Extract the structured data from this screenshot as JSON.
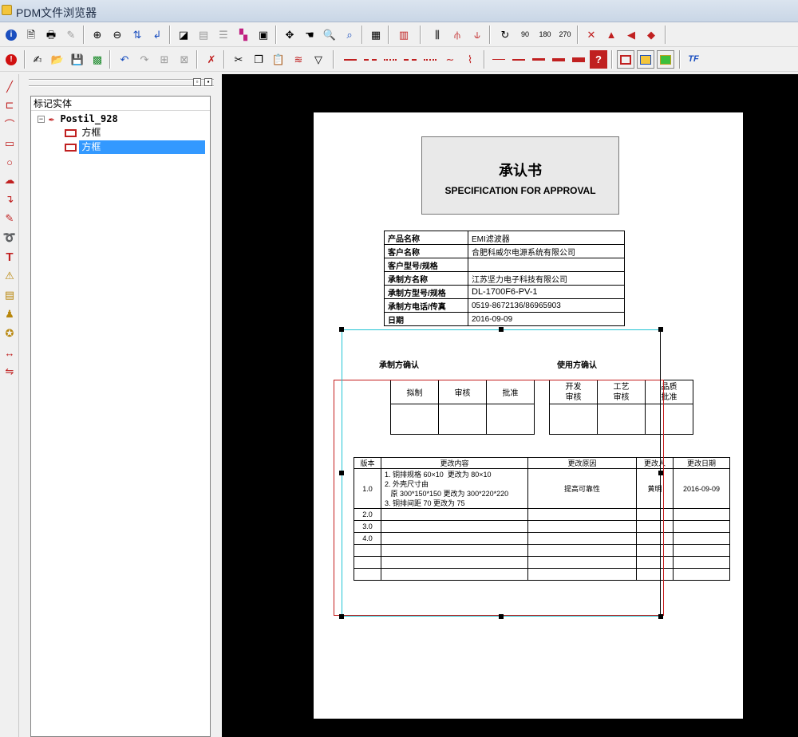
{
  "window": {
    "title": "PDM文件浏览器"
  },
  "toolbar1": {
    "buttons": [
      "info",
      "print-preview",
      "print",
      "pen",
      "zoom-in",
      "zoom-out",
      "fit",
      "pan-left",
      "fill",
      "gray",
      "layers",
      "layers-color",
      "frame",
      "arrow-up",
      "hand",
      "zoom-window",
      "zoom-extents",
      "properties",
      "ruler",
      "flip-h",
      "flip-v",
      "mirror",
      "rotate-0",
      "rotate-90",
      "rotate-180",
      "rotate-270",
      "delete-x",
      "warning",
      "flag-left",
      "flag-right"
    ],
    "rotate_labels": [
      "90",
      "180",
      "270"
    ]
  },
  "toolbar2": {
    "buttons": [
      "info",
      "edit",
      "open",
      "save",
      "save-green",
      "undo",
      "redo",
      "select-all",
      "deselect",
      "eraser",
      "cut",
      "copy",
      "paste",
      "stack",
      "triangle"
    ],
    "line_styles": [
      "solid",
      "dash",
      "dot",
      "dash-dot",
      "dash-dot-dot",
      "wave",
      "zigzag"
    ],
    "line_widths": [
      "thin",
      "normal",
      "medium",
      "thick",
      "heavy",
      "unknown"
    ],
    "colors": [
      "red-frame",
      "yellow-frame",
      "green-frame"
    ],
    "text_tool_label": "TF"
  },
  "left_tools": [
    "line",
    "polyline",
    "arc",
    "rectangle",
    "circle",
    "cloud",
    "arrow",
    "pen",
    "lasso",
    "text",
    "hatch",
    "note",
    "stamp",
    "globe",
    "dimension",
    "ruler-mark"
  ],
  "tree": {
    "header": "标记实体",
    "root": "Postil_928",
    "children": [
      "方框",
      "方框"
    ],
    "selected_index": 1
  },
  "document": {
    "title_cn": "承认书",
    "title_en": "SPECIFICATION FOR APPROVAL",
    "info_rows": [
      {
        "k": "产品名称",
        "v": "EMI滤波器"
      },
      {
        "k": "客户名称",
        "v": "合肥科威尔电源系统有限公司"
      },
      {
        "k": "客户型号/规格",
        "v": ""
      },
      {
        "k": "承制方名称",
        "v": "江苏坚力电子科技有限公司"
      },
      {
        "k": "承制方型号/规格",
        "v": "DL-1700F6-PV-1"
      },
      {
        "k": "承制方电话/传真",
        "v": "0519-8672136/86965903"
      },
      {
        "k": "日期",
        "v": "2016-09-09"
      }
    ],
    "maker_confirm": "承制方确认",
    "user_confirm": "使用方确认",
    "maker_roles": [
      "拟制",
      "审核",
      "批准"
    ],
    "user_roles": [
      "开发\n审核",
      "工艺\n审核",
      "品质\n批准"
    ],
    "rev_headers": [
      "版本",
      "更改内容",
      "更改原因",
      "更改人",
      "更改日期"
    ],
    "rev_rows": [
      {
        "ver": "1.0",
        "content": "1. 铜排规格 60×10  更改为 80×10\n2. 外壳尺寸由\n   原 300*150*150 更改为 300*220*220\n3. 铜排间距 70 更改为 75",
        "reason": "提高可靠性",
        "person": "黄明",
        "date": "2016-09-09"
      },
      {
        "ver": "2.0",
        "content": "",
        "reason": "",
        "person": "",
        "date": ""
      },
      {
        "ver": "3.0",
        "content": "",
        "reason": "",
        "person": "",
        "date": ""
      },
      {
        "ver": "4.0",
        "content": "",
        "reason": "",
        "person": "",
        "date": ""
      },
      {
        "ver": "",
        "content": "",
        "reason": "",
        "person": "",
        "date": ""
      },
      {
        "ver": "",
        "content": "",
        "reason": "",
        "person": "",
        "date": ""
      },
      {
        "ver": "",
        "content": "",
        "reason": "",
        "person": "",
        "date": ""
      }
    ]
  }
}
